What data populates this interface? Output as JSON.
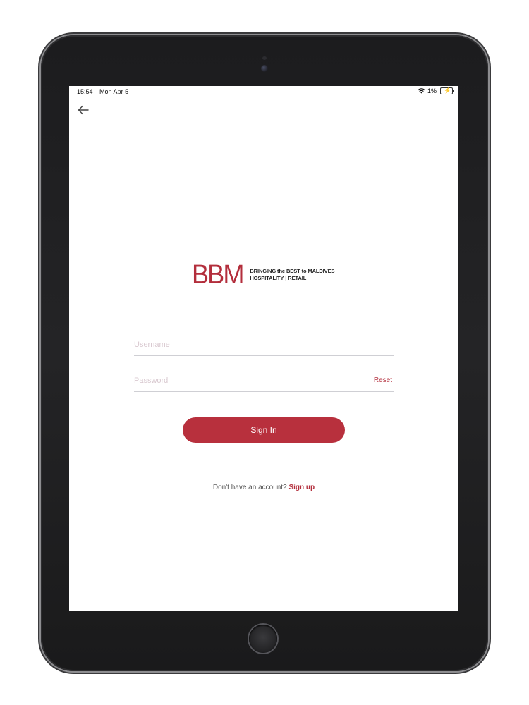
{
  "status_bar": {
    "time": "15:54",
    "date": "Mon Apr 5",
    "battery_percent": "1%",
    "wifi_icon": "wifi-icon",
    "battery_icon": "battery-charging-icon"
  },
  "nav": {
    "back_icon": "arrow-left-icon"
  },
  "logo": {
    "mark": "BBM",
    "tagline_line1": "BRINGING the BEST to MALDIVES",
    "tagline_line2a": "HOSPITALITY",
    "tagline_sep": "|",
    "tagline_line2b": "RETAIL"
  },
  "form": {
    "username": {
      "value": "",
      "placeholder": "Username"
    },
    "password": {
      "value": "",
      "placeholder": "Password"
    },
    "reset_label": "Reset",
    "signin_label": "Sign In"
  },
  "signup": {
    "prompt": "Don't have an account?",
    "link_label": "Sign up"
  },
  "colors": {
    "brand": "#b8303d",
    "bezel": "#1c1c1e",
    "divider": "#cfcfd4"
  }
}
